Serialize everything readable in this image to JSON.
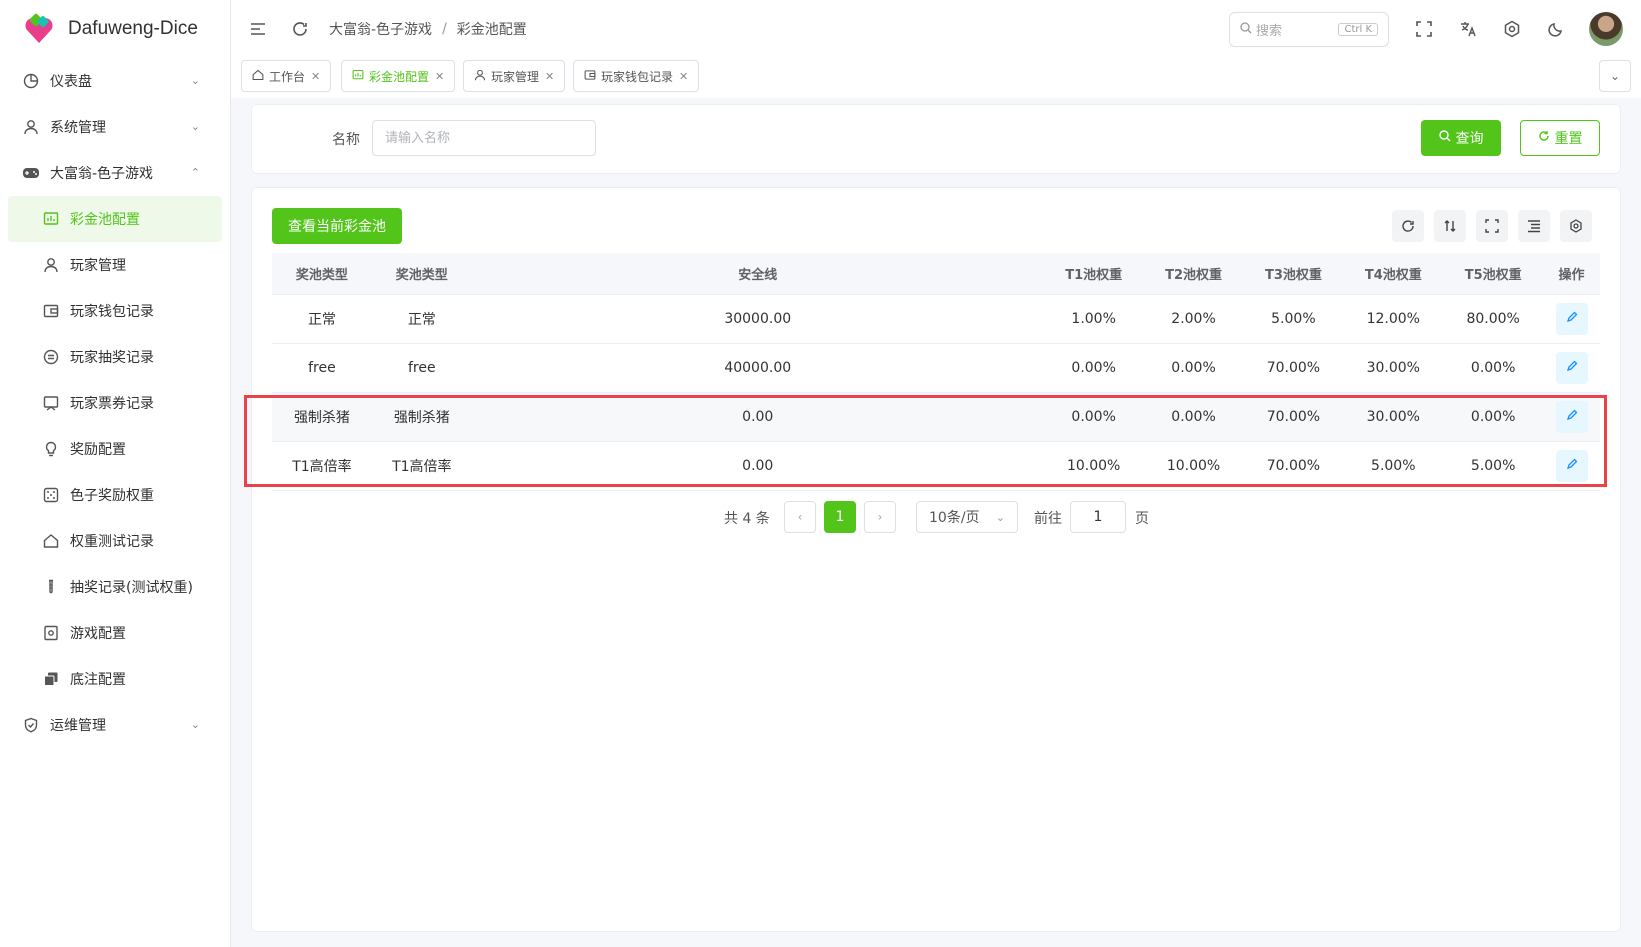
{
  "app": {
    "title": "Dafuweng-Dice"
  },
  "sidebar": {
    "items": [
      {
        "label": "仪表盘",
        "icon": "dashboard-icon",
        "expand": "down"
      },
      {
        "label": "系统管理",
        "icon": "user-icon",
        "expand": "down"
      },
      {
        "label": "大富翁-色子游戏",
        "icon": "gamepad-icon",
        "expand": "up"
      }
    ],
    "sub_items": [
      {
        "label": "彩金池配置",
        "icon": "chart-icon",
        "active": true
      },
      {
        "label": "玩家管理",
        "icon": "user-icon"
      },
      {
        "label": "玩家钱包记录",
        "icon": "wallet-icon"
      },
      {
        "label": "玩家抽奖记录",
        "icon": "lottery-icon"
      },
      {
        "label": "玩家票券记录",
        "icon": "ticket-icon"
      },
      {
        "label": "奖励配置",
        "icon": "bulb-icon"
      },
      {
        "label": "色子奖励权重",
        "icon": "dice-icon"
      },
      {
        "label": "权重测试记录",
        "icon": "home-icon"
      },
      {
        "label": "抽奖记录(测试权重)",
        "icon": "tube-icon"
      },
      {
        "label": "游戏配置",
        "icon": "settings-doc-icon"
      },
      {
        "label": "底注配置",
        "icon": "copy-icon"
      }
    ],
    "bottom_item": {
      "label": "运维管理",
      "icon": "shield-icon",
      "expand": "down"
    }
  },
  "header": {
    "breadcrumb": [
      "大富翁-色子游戏",
      "彩金池配置"
    ],
    "breadcrumb_sep": "/",
    "search_placeholder": "搜索",
    "search_shortcut": "Ctrl K"
  },
  "tabs": [
    {
      "label": "工作台",
      "icon": "home-icon",
      "active": false
    },
    {
      "label": "彩金池配置",
      "icon": "chart-icon",
      "active": true
    },
    {
      "label": "玩家管理",
      "icon": "user-icon",
      "active": false
    },
    {
      "label": "玩家钱包记录",
      "icon": "wallet-icon",
      "active": false
    }
  ],
  "filter": {
    "name_label": "名称",
    "name_placeholder": "请输入名称",
    "name_value": "",
    "query_label": "查询",
    "reset_label": "重置"
  },
  "toolbar": {
    "view_pool_label": "查看当前彩金池"
  },
  "table": {
    "columns": [
      "奖池类型",
      "奖池类型",
      "安全线",
      "T1池权重",
      "T2池权重",
      "T3池权重",
      "T4池权重",
      "T5池权重",
      "操作"
    ],
    "rows": [
      [
        "正常",
        "正常",
        "30000.00",
        "1.00%",
        "2.00%",
        "5.00%",
        "12.00%",
        "80.00%"
      ],
      [
        "free",
        "free",
        "40000.00",
        "0.00%",
        "0.00%",
        "70.00%",
        "30.00%",
        "0.00%"
      ],
      [
        "强制杀猪",
        "强制杀猪",
        "0.00",
        "0.00%",
        "0.00%",
        "70.00%",
        "30.00%",
        "0.00%"
      ],
      [
        "T1高倍率",
        "T1高倍率",
        "0.00",
        "10.00%",
        "10.00%",
        "70.00%",
        "5.00%",
        "5.00%"
      ]
    ]
  },
  "pagination": {
    "total_text": "共 4 条",
    "current_page": "1",
    "page_size": "10条/页",
    "goto_label": "前往",
    "goto_value": "1",
    "page_unit": "页"
  },
  "colors": {
    "accent": "#52c41a",
    "highlight_border": "#e8424a",
    "edit_icon": "#1890ff"
  }
}
